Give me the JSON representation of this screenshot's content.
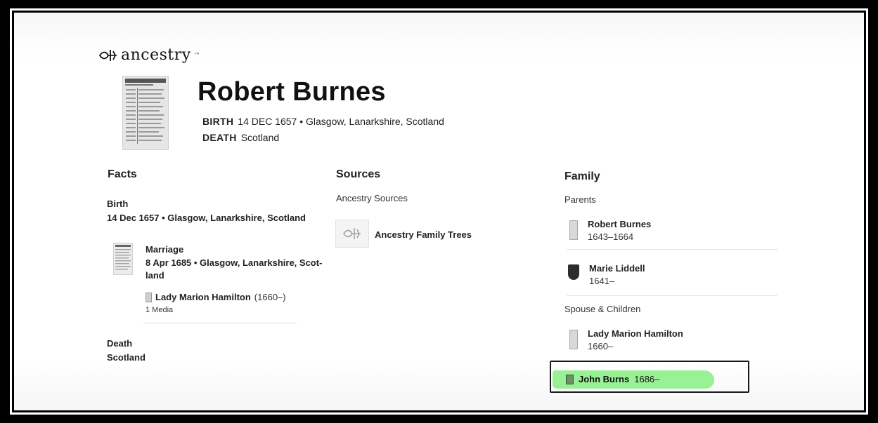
{
  "brand": {
    "name": "ancestry",
    "trademark": "™"
  },
  "person": {
    "name": "Robert Burnes",
    "birth_key": "BIRTH",
    "birth_value": "14 DEC 1657 • Glasgow, Lanarkshire, Scotland",
    "death_key": "DEATH",
    "death_value": "Scotland"
  },
  "facts": {
    "heading": "Facts",
    "birth_label": "Birth",
    "birth_value": "14 Dec 1657 • Glasgow, Lanarkshire, Scotland",
    "marriage_label": "Marriage",
    "marriage_value": "8 Apr 1685 • Glasgow, Lanarkshire, Scot-land",
    "marriage_spouse_name": "Lady Marion Hamilton",
    "marriage_spouse_years": "(1660–)",
    "media": "1 Media",
    "death_label": "Death",
    "death_value": "Scotland"
  },
  "sources": {
    "heading": "Sources",
    "subheading": "Ancestry Sources",
    "items": [
      {
        "title": "Ancestry Family Trees"
      }
    ]
  },
  "family": {
    "heading": "Family",
    "parents_label": "Parents",
    "parents": [
      {
        "name": "Robert Burnes",
        "years": "1643–1664",
        "icon": "record-icon"
      },
      {
        "name": "Marie Liddell",
        "years": "1641–",
        "icon": "crest-icon"
      }
    ],
    "spouse_children_label": "Spouse & Children",
    "spouse": {
      "name": "Lady Marion Hamilton",
      "years": "1660–"
    },
    "child": {
      "name": "John Burns",
      "years": "1686–"
    }
  },
  "colors": {
    "highlight": "#8ef08a",
    "frame": "#000000"
  }
}
